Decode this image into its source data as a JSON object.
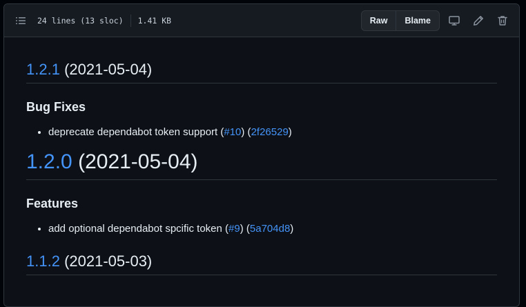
{
  "file_header": {
    "lines_info": "24 lines (13 sloc)",
    "size": "1.41 KB",
    "raw_label": "Raw",
    "blame_label": "Blame"
  },
  "icons": {
    "toc": "list-unordered-icon",
    "display": "device-desktop-icon",
    "edit": "pencil-icon",
    "delete": "trash-icon"
  },
  "sections": [
    {
      "version": "1.2.1",
      "date": "(2021-05-04)",
      "subheading": "Bug Fixes",
      "item": {
        "text": "deprecate dependabot token support (",
        "issue": "#10",
        "between": ") (",
        "commit": "2f26529",
        "end": ")"
      }
    },
    {
      "version": "1.2.0",
      "date": "(2021-05-04)",
      "subheading": "Features",
      "item": {
        "text": "add optional dependabot spcific token (",
        "issue": "#9",
        "between": ") (",
        "commit": "5a704d8",
        "end": ")"
      }
    },
    {
      "version": "1.1.2",
      "date": "(2021-05-03)"
    }
  ],
  "colors": {
    "background": "#0d1117",
    "header": "#161b22",
    "border": "#30363d",
    "link": "#4493f8",
    "text": "#e6edf3"
  }
}
